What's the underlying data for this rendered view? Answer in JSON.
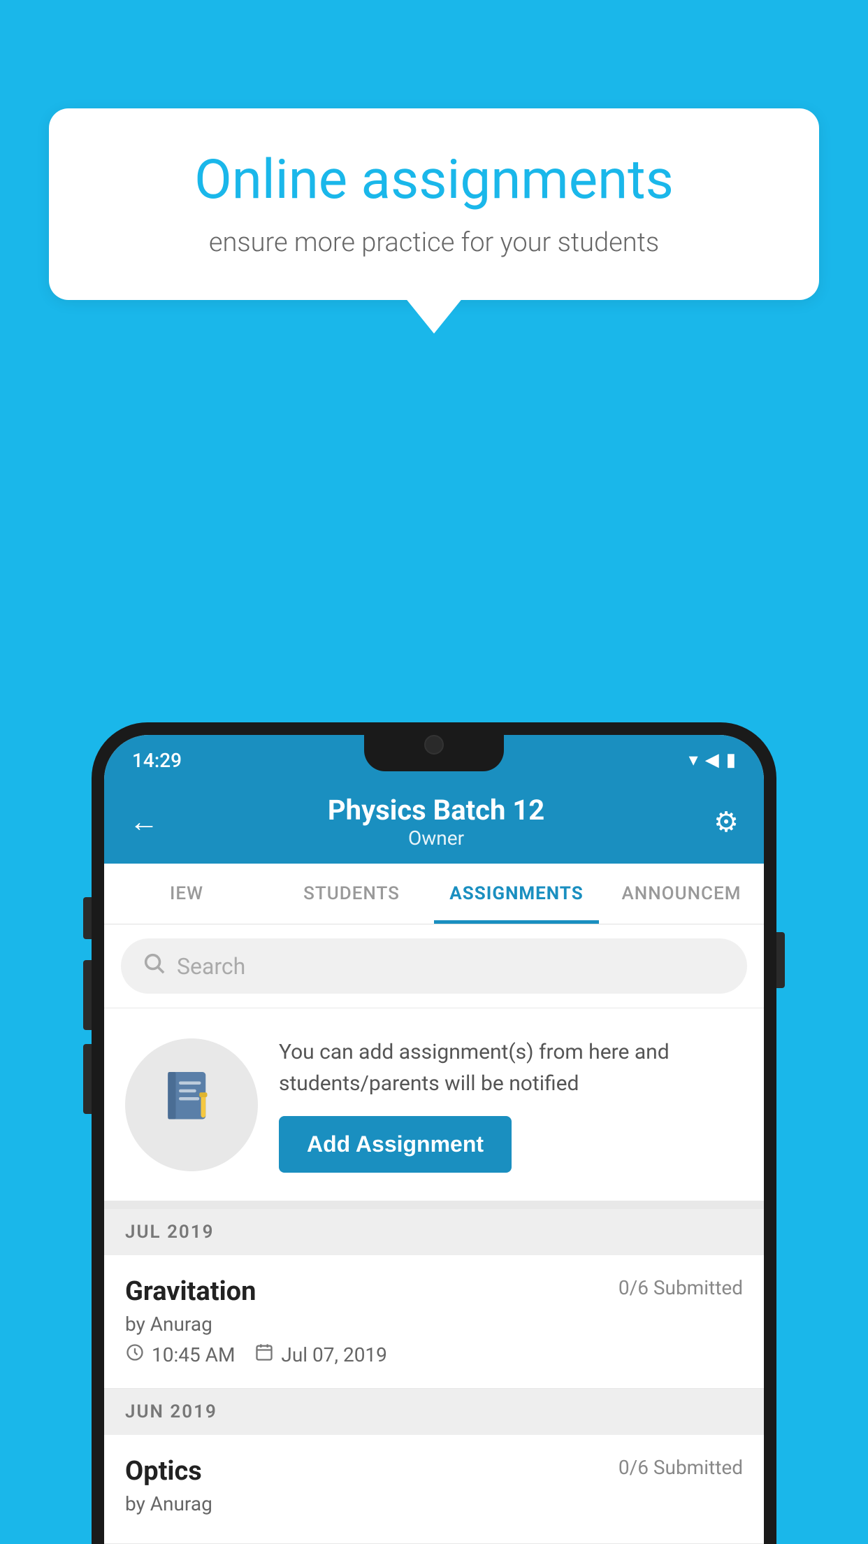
{
  "background": {
    "color": "#1ab7ea"
  },
  "speech_bubble": {
    "title": "Online assignments",
    "subtitle": "ensure more practice for your students"
  },
  "status_bar": {
    "time": "14:29",
    "wifi": "▲",
    "signal": "▲",
    "battery": "▮"
  },
  "header": {
    "title": "Physics Batch 12",
    "subtitle": "Owner",
    "back_label": "←",
    "settings_label": "⚙"
  },
  "tabs": [
    {
      "id": "view",
      "label": "IEW",
      "active": false
    },
    {
      "id": "students",
      "label": "STUDENTS",
      "active": false
    },
    {
      "id": "assignments",
      "label": "ASSIGNMENTS",
      "active": true
    },
    {
      "id": "announcements",
      "label": "ANNOUNCEM",
      "active": false
    }
  ],
  "search": {
    "placeholder": "Search"
  },
  "add_section": {
    "info_text": "You can add assignment(s) from here and students/parents will be notified",
    "button_label": "Add Assignment"
  },
  "months": [
    {
      "label": "JUL 2019",
      "assignments": [
        {
          "name": "Gravitation",
          "submitted": "0/6 Submitted",
          "author": "by Anurag",
          "time": "10:45 AM",
          "date": "Jul 07, 2019"
        }
      ]
    },
    {
      "label": "JUN 2019",
      "assignments": [
        {
          "name": "Optics",
          "submitted": "0/6 Submitted",
          "author": "by Anurag",
          "time": "",
          "date": ""
        }
      ]
    }
  ]
}
